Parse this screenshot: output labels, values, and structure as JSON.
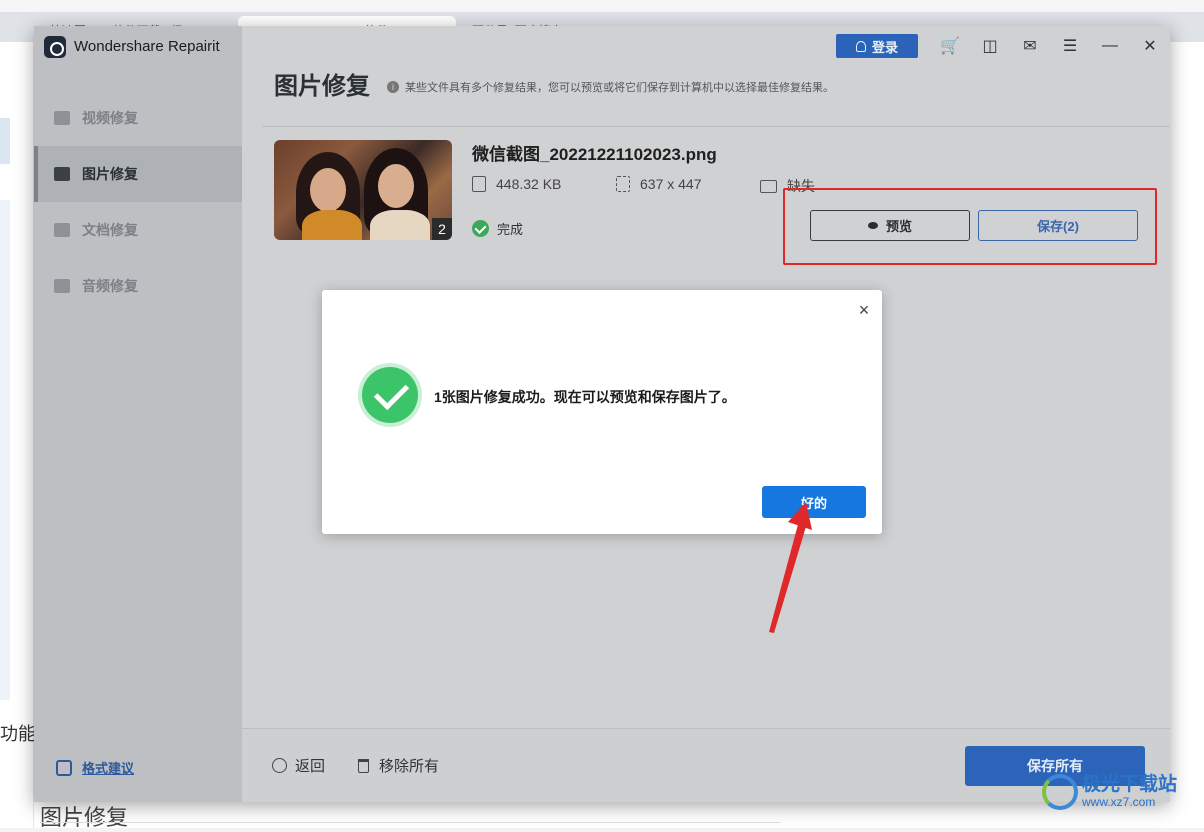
{
  "browser": {
    "tabs": [
      {
        "label": "快速图OCR软件下载 - 极"
      },
      {
        "label": "Wondershare Repairit软件"
      },
      {
        "label": "百分号_百度搜索"
      }
    ],
    "page_text_left": "功能，",
    "page_text_bottom": "图片修复"
  },
  "app": {
    "title": "Wondershare Repairit",
    "login_label": "登录",
    "sidebar": {
      "items": [
        {
          "label": "视频修复",
          "icon": "video-icon",
          "active": false
        },
        {
          "label": "图片修复",
          "icon": "image-icon",
          "active": true
        },
        {
          "label": "文档修复",
          "icon": "document-icon",
          "active": false
        },
        {
          "label": "音频修复",
          "icon": "audio-icon",
          "active": false
        }
      ],
      "suggest_label": "格式建议"
    },
    "page": {
      "title": "图片修复",
      "hint": "某些文件具有多个修复结果，您可以预览或将它们保存到计算机中以选择最佳修复结果。"
    },
    "file": {
      "name": "微信截图_20221221102023.png",
      "size": "448.32  KB",
      "dimensions": "637 x 447",
      "missing": "缺失",
      "status": "完成",
      "result_count": "2"
    },
    "buttons": {
      "preview": "预览",
      "save": "保存(2)",
      "back": "返回",
      "remove_all": "移除所有",
      "save_all": "保存所有"
    }
  },
  "dialog": {
    "message": "1张图片修复成功。现在可以预览和保存图片了。",
    "ok_label": "好的",
    "close_glyph": "×"
  },
  "colors": {
    "accent": "#2b64b8",
    "success": "#3cc468",
    "highlight": "#e0282a",
    "dialog_button": "#1677e0"
  },
  "watermark": {
    "name": "极光下载站",
    "url": "www.xz7.com"
  }
}
